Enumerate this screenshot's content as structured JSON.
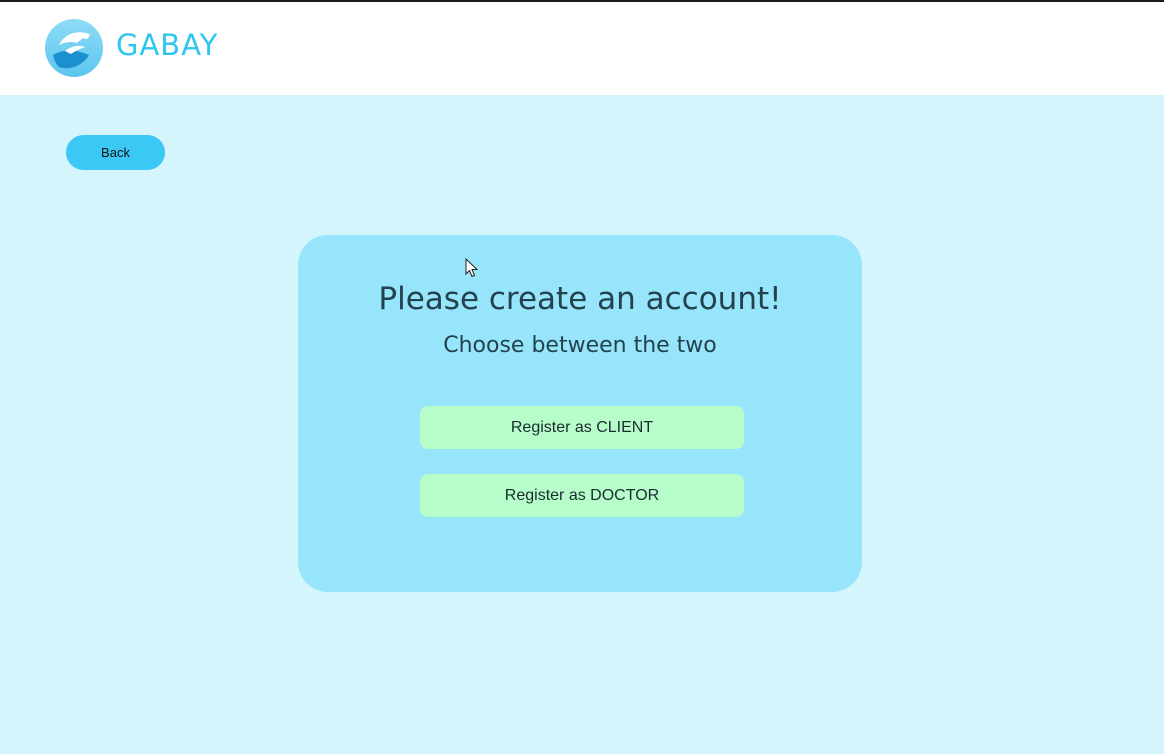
{
  "header": {
    "brand": "GABAY",
    "logo_icon": "caring-hands-logo-icon"
  },
  "nav": {
    "back_label": "Back"
  },
  "card": {
    "title": "Please create an account!",
    "subtitle": "Choose between the two",
    "client_button": "Register as CLIENT",
    "doctor_button": "Register as DOCTOR"
  },
  "colors": {
    "page_background": "#d5f5fd",
    "header_background": "#ffffff",
    "brand": "#2ec6ef",
    "back_button": "#3bc8f5",
    "card": "#97e5fb",
    "register_button": "#b6fdc9",
    "heading_text": "#24424d"
  }
}
